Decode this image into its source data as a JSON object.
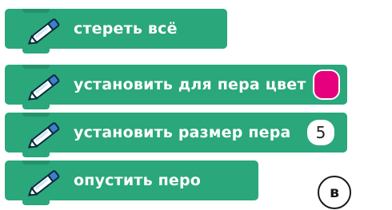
{
  "blocks": [
    {
      "label": "стереть всё",
      "icon": "pen-icon"
    },
    {
      "label": "установить для пера цвет",
      "icon": "pen-icon",
      "color_value": "#e6007e"
    },
    {
      "label": "установить размер пера",
      "icon": "pen-icon",
      "size_value": "5"
    },
    {
      "label": "опустить перо",
      "icon": "pen-icon"
    }
  ],
  "figure_label": "в",
  "colors": {
    "block": "#2aa77b",
    "pen_color": "#e6007e"
  }
}
